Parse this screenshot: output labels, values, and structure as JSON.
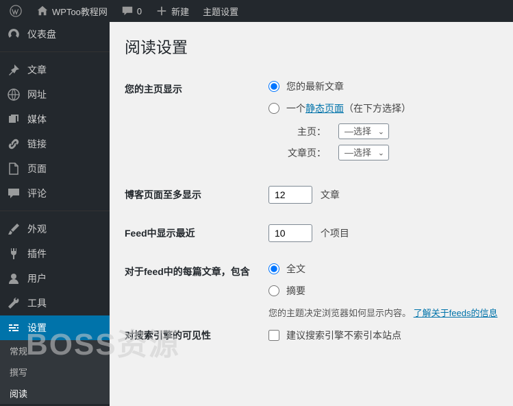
{
  "adminbar": {
    "site_title": "WPToo教程网",
    "comments_count": "0",
    "new_label": "新建",
    "theme_settings": "主题设置"
  },
  "sidebar": {
    "items": [
      {
        "label": "仪表盘"
      },
      {
        "label": "文章"
      },
      {
        "label": "网址"
      },
      {
        "label": "媒体"
      },
      {
        "label": "链接"
      },
      {
        "label": "页面"
      },
      {
        "label": "评论"
      },
      {
        "label": "外观"
      },
      {
        "label": "插件"
      },
      {
        "label": "用户"
      },
      {
        "label": "工具"
      },
      {
        "label": "设置"
      }
    ],
    "submenu": [
      {
        "label": "常规"
      },
      {
        "label": "撰写"
      },
      {
        "label": "阅读"
      }
    ]
  },
  "page": {
    "title": "阅读设置",
    "watermark": "BOSS资源",
    "homepage": {
      "label": "您的主页显示",
      "opt_latest": "您的最新文章",
      "opt_static_prefix": "一个",
      "opt_static_link": "静态页面",
      "opt_static_suffix": "（在下方选择）",
      "home_label": "主页：",
      "posts_label": "文章页：",
      "select_placeholder": "—选择"
    },
    "blog_pages": {
      "label": "博客页面至多显示",
      "value": "12",
      "unit": "文章"
    },
    "feed_count": {
      "label": "Feed中显示最近",
      "value": "10",
      "unit": "个项目"
    },
    "feed_content": {
      "label": "对于feed中的每篇文章，包含",
      "opt_full": "全文",
      "opt_summary": "摘要",
      "desc_prefix": "您的主题决定浏览器如何显示内容。",
      "desc_link": "了解关于feeds的信息"
    },
    "search_engine": {
      "label": "对搜索引擎的可见性",
      "checkbox": "建议搜索引擎不索引本站点"
    }
  }
}
